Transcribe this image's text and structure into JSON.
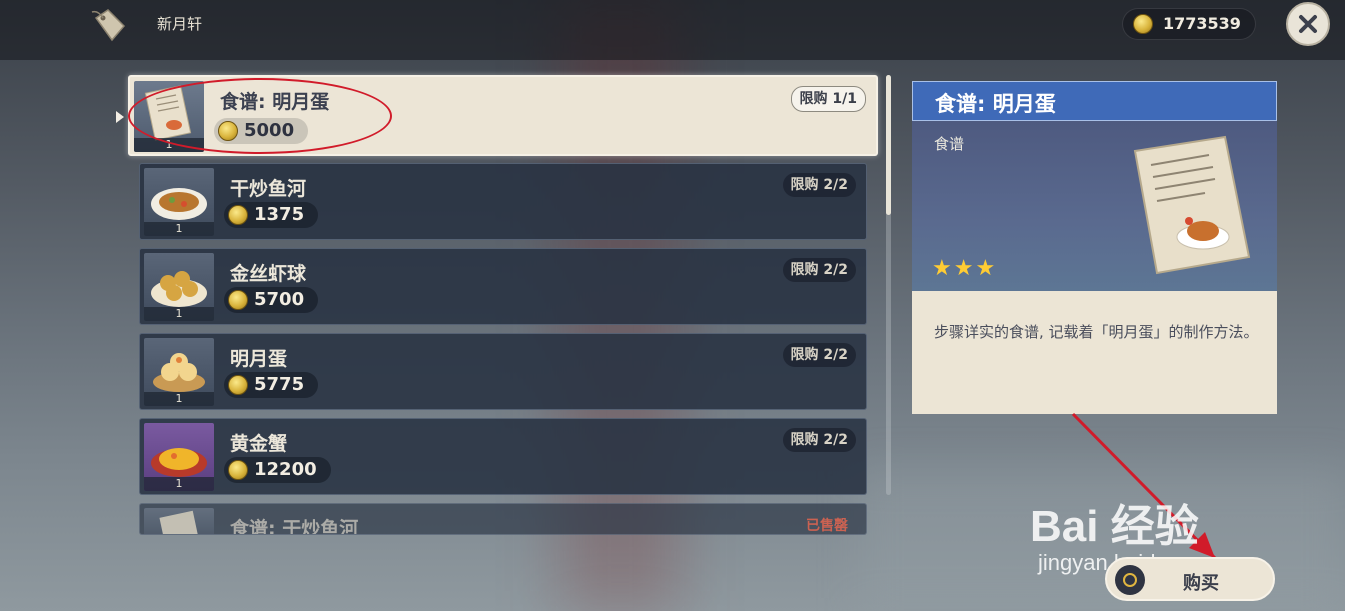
{
  "header": {
    "shop_title": "新月轩",
    "currency_amount": "1773539"
  },
  "items": [
    {
      "name": "食谱: 明月蛋",
      "price": "5000",
      "limit": "限购 1/1",
      "qty": "1",
      "selected": true
    },
    {
      "name": "干炒鱼河",
      "price": "1375",
      "limit": "限购 2/2",
      "qty": "1"
    },
    {
      "name": "金丝虾球",
      "price": "5700",
      "limit": "限购 2/2",
      "qty": "1"
    },
    {
      "name": "明月蛋",
      "price": "5775",
      "limit": "限购 2/2",
      "qty": "1"
    },
    {
      "name": "黄金蟹",
      "price": "12200",
      "limit": "限购 2/2",
      "qty": "1"
    },
    {
      "name": "食谱: 干炒鱼河",
      "limit": "已售罄",
      "sold_out": true
    }
  ],
  "detail": {
    "title": "食谱: 明月蛋",
    "category": "食谱",
    "stars": "★★★",
    "description": "步骤详实的食谱, 记载着「明月蛋」的制作方法。"
  },
  "buy_button": {
    "label": "购买"
  },
  "watermark": {
    "main": "Bai 经验",
    "url": "jingyan.baidu.com"
  },
  "colors": {
    "accent_blue": "#3f6ab8",
    "panel_cream": "#ece5d6",
    "annotation_red": "#d11b2a",
    "sold_out_red": "#e3543c"
  }
}
